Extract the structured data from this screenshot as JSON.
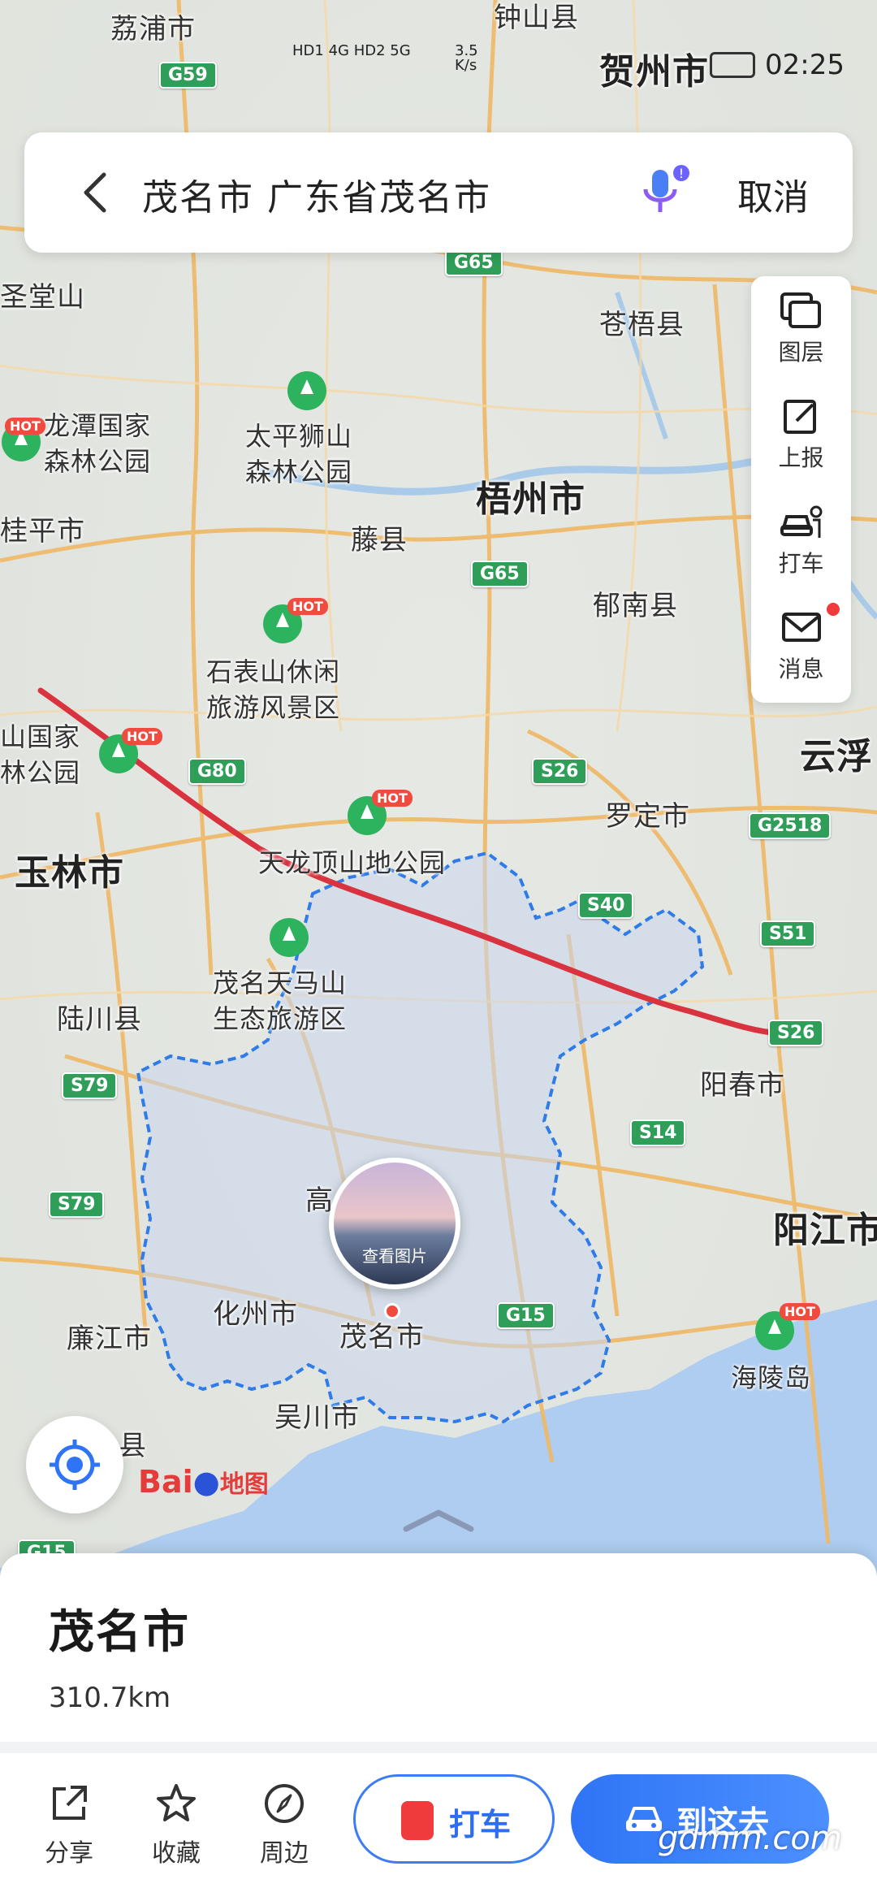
{
  "status_bar": {
    "network": "HD1 4G  HD2 5G",
    "speed": "3.5\nK/s",
    "time": "02:25"
  },
  "search": {
    "query": "茂名市 广东省茂名市",
    "cancel_label": "取消"
  },
  "tools": [
    {
      "label": "图层",
      "icon": "layers-icon"
    },
    {
      "label": "上报",
      "icon": "report-icon"
    },
    {
      "label": "打车",
      "icon": "taxi-icon"
    },
    {
      "label": "消息",
      "icon": "message-icon",
      "badge": true
    }
  ],
  "map": {
    "cities": [
      {
        "name": "荔浦市"
      },
      {
        "name": "钟山县"
      },
      {
        "name": "贺州市"
      },
      {
        "name": "苍梧县"
      },
      {
        "name": "梧州市"
      },
      {
        "name": "藤县"
      },
      {
        "name": "郁南县"
      },
      {
        "name": "云浮"
      },
      {
        "name": "罗定市"
      },
      {
        "name": "玉林市"
      },
      {
        "name": "陆川县"
      },
      {
        "name": "阳春市"
      },
      {
        "name": "阳江市"
      },
      {
        "name": "廉江市"
      },
      {
        "name": "化州市"
      },
      {
        "name": "吴川市"
      },
      {
        "name": "茂名市"
      },
      {
        "name": "圣堂山"
      },
      {
        "name": "桂平市"
      },
      {
        "name": "高"
      },
      {
        "name": "县"
      }
    ],
    "pois": [
      {
        "name": "龙潭国家\n森林公园",
        "hot": true
      },
      {
        "name": "太平狮山\n森林公园",
        "hot": false
      },
      {
        "name": "石表山休闲\n旅游风景区",
        "hot": true
      },
      {
        "name": "山国家\n林公园",
        "hot": true
      },
      {
        "name": "天龙顶山地公园",
        "hot": true
      },
      {
        "name": "茂名天马山\n生态旅游区",
        "hot": false
      },
      {
        "name": "海陵岛",
        "hot": true
      }
    ],
    "roads": [
      "G59",
      "G65",
      "G65",
      "G80",
      "S26",
      "G2518",
      "S40",
      "S51",
      "S26",
      "S79",
      "S14",
      "S79",
      "G15",
      "G15"
    ],
    "hot_label": "HOT",
    "photo_caption": "查看图片",
    "logo_text": "Bai",
    "logo_text2": "地图"
  },
  "place_card": {
    "title": "茂名市",
    "distance": "310.7km",
    "actions": [
      {
        "label": "分享",
        "icon": "share-icon"
      },
      {
        "label": "收藏",
        "icon": "star-icon"
      },
      {
        "label": "周边",
        "icon": "compass-icon"
      }
    ],
    "taxi_button": "打车",
    "go_button": "到这去"
  },
  "watermark": "gdmm.com",
  "colors": {
    "accent": "#3c7df6",
    "route": "#d9333f",
    "boundary": "#2f7be8",
    "road_shield": "#2f9e59",
    "hot": "#ef4b3f"
  }
}
